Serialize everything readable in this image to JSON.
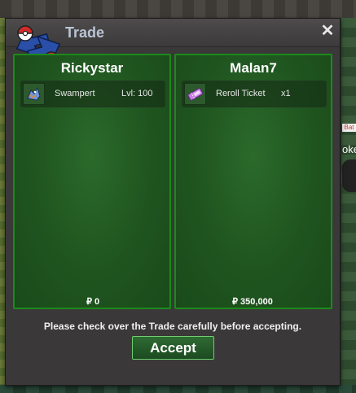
{
  "window": {
    "title": "Trade",
    "close_label": "✕",
    "notice": "Please check over the Trade carefully before accepting.",
    "accept_label": "Accept"
  },
  "left_panel": {
    "player": "Rickystar",
    "item": {
      "name": "Swampert",
      "extra": "Lvl: 100",
      "icon": "pokemon-icon"
    },
    "money": "₽ 0"
  },
  "right_panel": {
    "player": "Malan7",
    "item": {
      "name": "Reroll Ticket",
      "extra": "x1",
      "icon": "ticket-icon"
    },
    "money": "₽ 350,000"
  },
  "background": {
    "side_tag": "Bat",
    "side_text": "oke"
  },
  "colors": {
    "panel_border": "#1c8a1c",
    "panel_fill": "#1f541f",
    "title": "#b9c4d4",
    "accept_border": "#6fcf6f"
  }
}
